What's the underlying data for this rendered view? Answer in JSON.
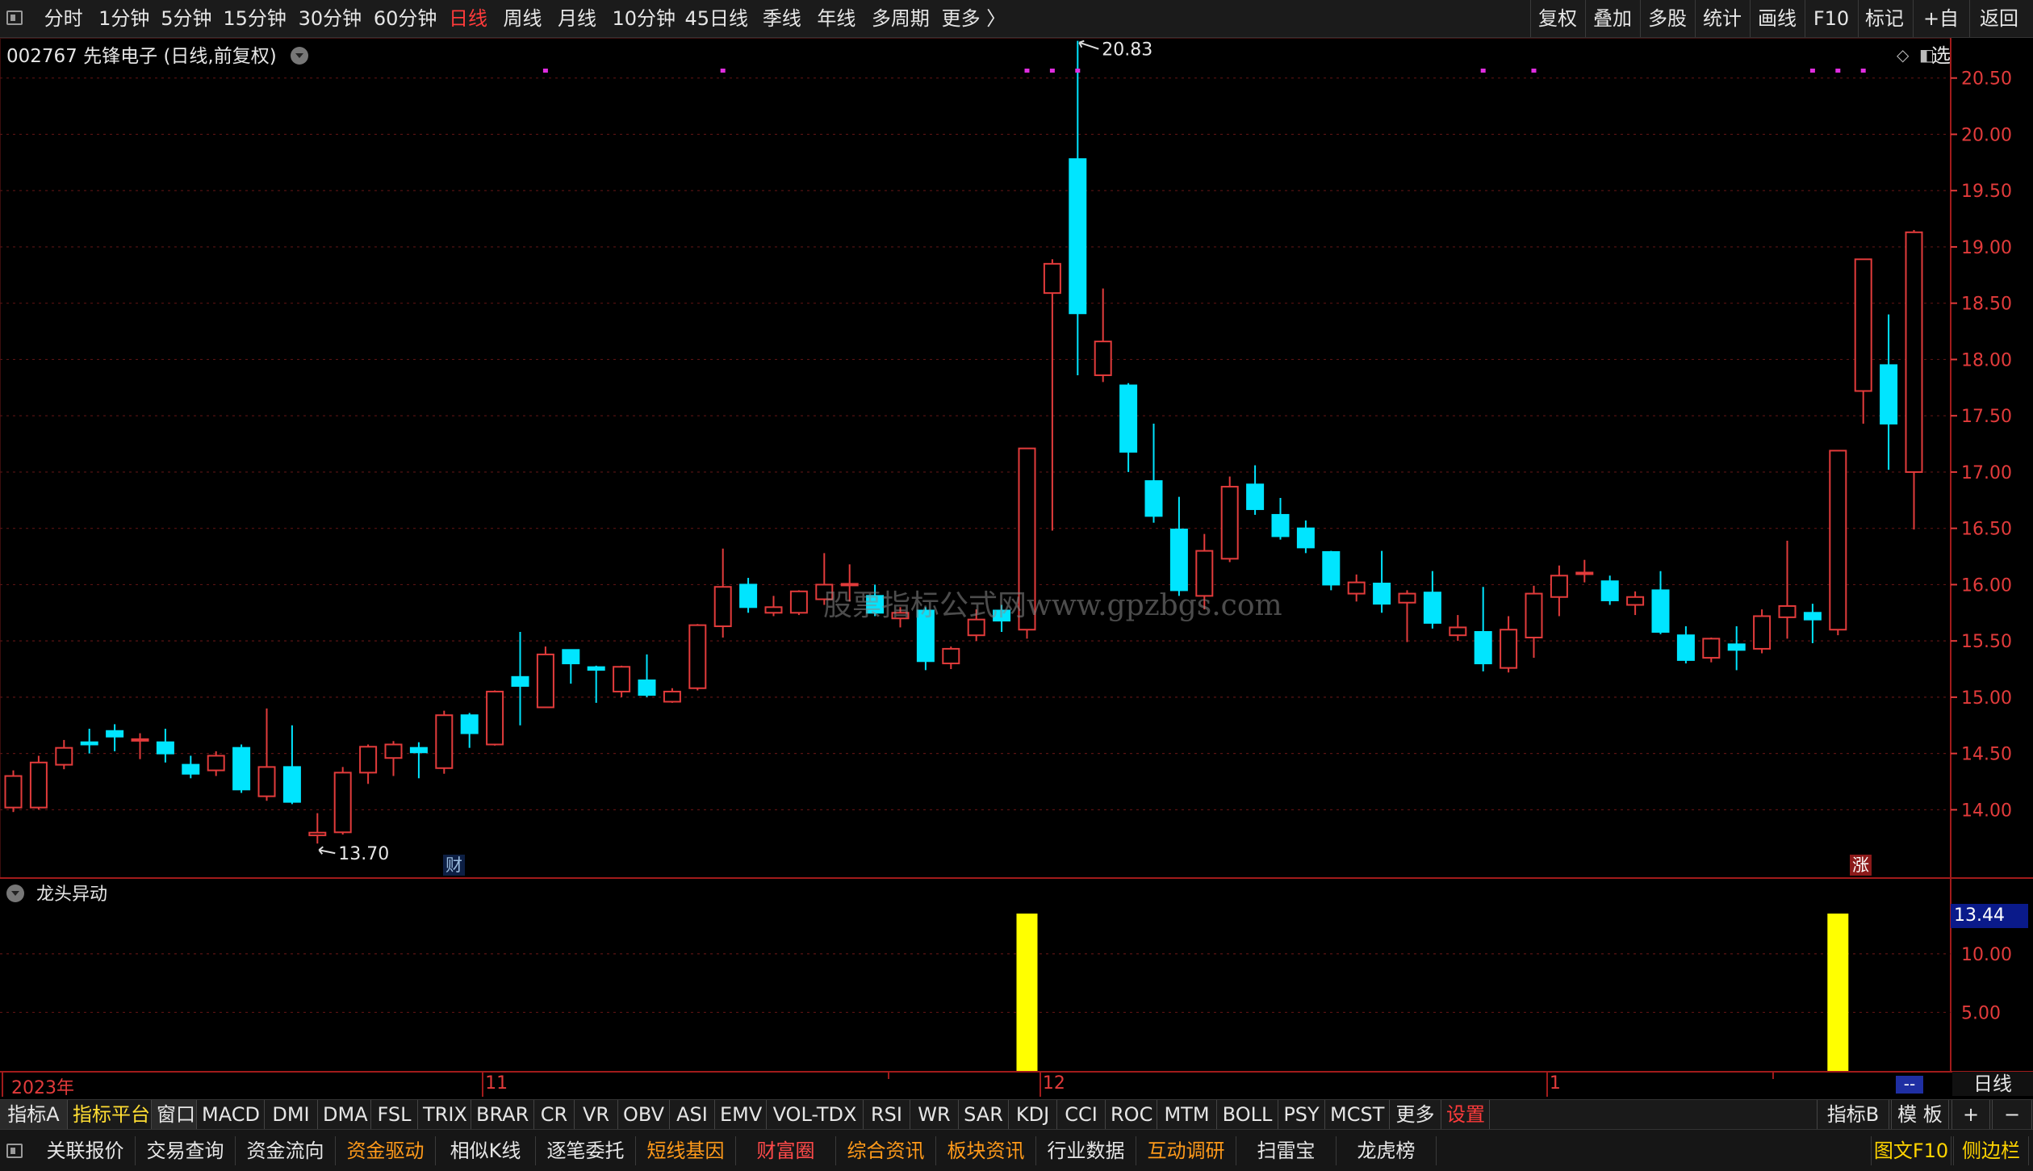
{
  "topbar": {
    "periods": [
      {
        "label": "分时",
        "active": false
      },
      {
        "label": "1分钟",
        "active": false
      },
      {
        "label": "5分钟",
        "active": false
      },
      {
        "label": "15分钟",
        "active": false
      },
      {
        "label": "30分钟",
        "active": false
      },
      {
        "label": "60分钟",
        "active": false
      },
      {
        "label": "日线",
        "active": true
      },
      {
        "label": "周线",
        "active": false
      },
      {
        "label": "月线",
        "active": false
      },
      {
        "label": "10分钟",
        "active": false
      },
      {
        "label": "45日线",
        "active": false
      },
      {
        "label": "季线",
        "active": false
      },
      {
        "label": "年线",
        "active": false
      },
      {
        "label": "多周期",
        "active": false
      },
      {
        "label": "更多 〉",
        "active": false
      }
    ],
    "right_tools": [
      "复权",
      "叠加",
      "多股",
      "统计",
      "画线",
      "F10",
      "标记",
      "+自选",
      "返回"
    ]
  },
  "chart_header": {
    "code": "002767",
    "name": "先锋电子",
    "mode": "(日线,前复权)"
  },
  "watermark": "股票指标公式网www.gpzbgs.com",
  "annotations": {
    "high_label": "20.83",
    "low_label": "13.70",
    "cai": "财",
    "zhang": "涨"
  },
  "colors": {
    "up": "#e23b3b",
    "down": "#00e5ff",
    "indicator": "#ffff00",
    "marker": "#e02de0",
    "axis": "#e23b3b"
  },
  "chart_data": {
    "type": "candlestick",
    "ylim": [
      13.3,
      21.2
    ],
    "y_ticks": [
      "20.50",
      "20.00",
      "19.50",
      "19.00",
      "18.50",
      "18.00",
      "17.50",
      "17.00",
      "16.50",
      "16.00",
      "15.50",
      "15.00",
      "14.50",
      "14.00"
    ],
    "candles": [
      [
        14.02,
        14.3,
        13.98,
        14.35
      ],
      [
        14.02,
        14.42,
        14.0,
        14.48
      ],
      [
        14.4,
        14.55,
        14.36,
        14.62
      ],
      [
        14.6,
        14.58,
        14.5,
        14.72
      ],
      [
        14.7,
        14.65,
        14.52,
        14.76
      ],
      [
        14.62,
        14.62,
        14.45,
        14.68
      ],
      [
        14.6,
        14.5,
        14.42,
        14.72
      ],
      [
        14.4,
        14.32,
        14.28,
        14.48
      ],
      [
        14.35,
        14.48,
        14.3,
        14.52
      ],
      [
        14.55,
        14.18,
        14.15,
        14.58
      ],
      [
        14.12,
        14.38,
        14.08,
        14.9
      ],
      [
        14.38,
        14.07,
        14.05,
        14.75
      ],
      [
        13.78,
        13.79,
        13.7,
        13.97
      ],
      [
        13.8,
        14.33,
        13.78,
        14.38
      ],
      [
        14.33,
        14.56,
        14.23,
        14.58
      ],
      [
        14.46,
        14.58,
        14.3,
        14.61
      ],
      [
        14.55,
        14.51,
        14.28,
        14.6
      ],
      [
        14.37,
        14.84,
        14.32,
        14.88
      ],
      [
        14.84,
        14.68,
        14.55,
        14.86
      ],
      [
        14.58,
        15.05,
        14.57,
        15.06
      ],
      [
        15.18,
        15.1,
        14.75,
        15.58
      ],
      [
        14.91,
        15.38,
        14.91,
        15.45
      ],
      [
        15.42,
        15.3,
        15.12,
        15.42
      ],
      [
        15.26,
        15.25,
        14.95,
        15.28
      ],
      [
        15.05,
        15.27,
        15.0,
        15.28
      ],
      [
        15.15,
        15.02,
        15.0,
        15.38
      ],
      [
        14.96,
        15.05,
        14.95,
        15.08
      ],
      [
        15.08,
        15.64,
        15.06,
        15.65
      ],
      [
        15.63,
        15.98,
        15.53,
        16.32
      ],
      [
        16.0,
        15.8,
        15.75,
        16.06
      ],
      [
        15.75,
        15.8,
        15.72,
        15.9
      ],
      [
        15.75,
        15.94,
        15.73,
        15.95
      ],
      [
        15.87,
        16.0,
        15.82,
        16.28
      ],
      [
        16.0,
        16.0,
        15.85,
        16.18
      ],
      [
        15.9,
        15.75,
        15.72,
        16.0
      ],
      [
        15.7,
        15.75,
        15.62,
        15.8
      ],
      [
        15.77,
        15.32,
        15.24,
        15.8
      ],
      [
        15.3,
        15.43,
        15.25,
        15.45
      ],
      [
        15.55,
        15.69,
        15.5,
        15.78
      ],
      [
        15.77,
        15.68,
        15.58,
        15.82
      ],
      [
        15.6,
        17.21,
        15.52,
        17.21
      ],
      [
        18.59,
        18.85,
        16.48,
        18.89
      ],
      [
        19.78,
        18.41,
        17.86,
        20.83
      ],
      [
        17.86,
        18.16,
        17.8,
        18.63
      ],
      [
        17.77,
        17.18,
        17.0,
        17.79
      ],
      [
        16.92,
        16.61,
        16.55,
        17.43
      ],
      [
        16.49,
        15.95,
        15.9,
        16.78
      ],
      [
        15.9,
        16.3,
        15.78,
        16.45
      ],
      [
        16.23,
        16.87,
        16.2,
        16.96
      ],
      [
        16.89,
        16.67,
        16.62,
        17.06
      ],
      [
        16.62,
        16.43,
        16.4,
        16.77
      ],
      [
        16.5,
        16.33,
        16.28,
        16.57
      ],
      [
        16.29,
        16.0,
        15.95,
        16.3
      ],
      [
        15.92,
        16.02,
        15.85,
        16.09
      ],
      [
        16.01,
        15.83,
        15.75,
        16.3
      ],
      [
        15.84,
        15.92,
        15.49,
        15.95
      ],
      [
        15.93,
        15.66,
        15.61,
        16.12
      ],
      [
        15.55,
        15.62,
        15.5,
        15.73
      ],
      [
        15.58,
        15.3,
        15.23,
        15.98
      ],
      [
        15.26,
        15.6,
        15.22,
        15.72
      ],
      [
        15.53,
        15.92,
        15.35,
        15.99
      ],
      [
        15.89,
        16.08,
        15.72,
        16.17
      ],
      [
        16.1,
        16.1,
        16.02,
        16.22
      ],
      [
        16.03,
        15.86,
        15.82,
        16.08
      ],
      [
        15.82,
        15.89,
        15.73,
        15.94
      ],
      [
        15.95,
        15.58,
        15.56,
        16.12
      ],
      [
        15.55,
        15.33,
        15.3,
        15.63
      ],
      [
        15.35,
        15.52,
        15.31,
        15.53
      ],
      [
        15.47,
        15.42,
        15.24,
        15.63
      ],
      [
        15.43,
        15.72,
        15.39,
        15.78
      ],
      [
        15.71,
        15.81,
        15.52,
        16.39
      ],
      [
        15.75,
        15.69,
        15.48,
        15.83
      ],
      [
        15.6,
        17.19,
        15.55,
        17.19
      ],
      [
        17.72,
        18.89,
        17.43,
        18.89
      ],
      [
        17.95,
        17.43,
        17.02,
        18.4
      ],
      [
        17.0,
        19.13,
        16.49,
        19.15
      ]
    ],
    "markers_top": [
      21,
      28,
      40,
      41,
      42,
      58,
      60,
      71,
      72,
      73
    ],
    "sub_indicator": {
      "title": "龙头异动",
      "value_label": "13.44",
      "ylim": [
        0,
        15.5
      ],
      "y_ticks": [
        "10.00",
        "5.00"
      ],
      "bars": [
        {
          "index": 40,
          "value": 13.44
        },
        {
          "index": 72,
          "value": 13.44
        }
      ]
    }
  },
  "date_axis": [
    {
      "label": "2023年",
      "index": 0
    },
    {
      "label": "11",
      "index": 19
    },
    {
      "label": "12",
      "index": 41
    },
    {
      "label": "1",
      "index": 61
    }
  ],
  "period_label": "日线",
  "dashdash": "--",
  "indicator_tabs": [
    {
      "label": "指标A",
      "style": "sel"
    },
    {
      "label": "指标平台",
      "style": "hl"
    },
    {
      "label": "窗口",
      "style": "sel"
    },
    {
      "label": "MACD",
      "style": ""
    },
    {
      "label": "DMI",
      "style": ""
    },
    {
      "label": "DMA",
      "style": ""
    },
    {
      "label": "FSL",
      "style": ""
    },
    {
      "label": "TRIX",
      "style": ""
    },
    {
      "label": "BRAR",
      "style": ""
    },
    {
      "label": "CR",
      "style": ""
    },
    {
      "label": "VR",
      "style": ""
    },
    {
      "label": "OBV",
      "style": ""
    },
    {
      "label": "ASI",
      "style": ""
    },
    {
      "label": "EMV",
      "style": ""
    },
    {
      "label": "VOL-TDX",
      "style": ""
    },
    {
      "label": "RSI",
      "style": ""
    },
    {
      "label": "WR",
      "style": ""
    },
    {
      "label": "SAR",
      "style": ""
    },
    {
      "label": "KDJ",
      "style": ""
    },
    {
      "label": "CCI",
      "style": ""
    },
    {
      "label": "ROC",
      "style": ""
    },
    {
      "label": "MTM",
      "style": ""
    },
    {
      "label": "BOLL",
      "style": ""
    },
    {
      "label": "PSY",
      "style": ""
    },
    {
      "label": "MCST",
      "style": ""
    },
    {
      "label": "更多",
      "style": ""
    },
    {
      "label": "设置",
      "style": "red"
    }
  ],
  "indicator_right": [
    "指标B",
    "模 板",
    "+",
    "−"
  ],
  "bottom_tabs": [
    {
      "label": "关联报价",
      "style": ""
    },
    {
      "label": "交易查询",
      "style": ""
    },
    {
      "label": "资金流向",
      "style": ""
    },
    {
      "label": "资金驱动",
      "style": "o"
    },
    {
      "label": "相似K线",
      "style": ""
    },
    {
      "label": "逐笔委托",
      "style": ""
    },
    {
      "label": "短线基因",
      "style": "o"
    },
    {
      "label": "财富圈",
      "style": "r"
    },
    {
      "label": "综合资讯",
      "style": "o"
    },
    {
      "label": "板块资讯",
      "style": "o"
    },
    {
      "label": "行业数据",
      "style": ""
    },
    {
      "label": "互动调研",
      "style": "o"
    },
    {
      "label": "扫雷宝",
      "style": ""
    },
    {
      "label": "龙虎榜",
      "style": ""
    }
  ],
  "bottom_right": [
    {
      "label": "图文F10",
      "style": "y"
    },
    {
      "label": "侧边栏",
      "style": "y"
    }
  ]
}
